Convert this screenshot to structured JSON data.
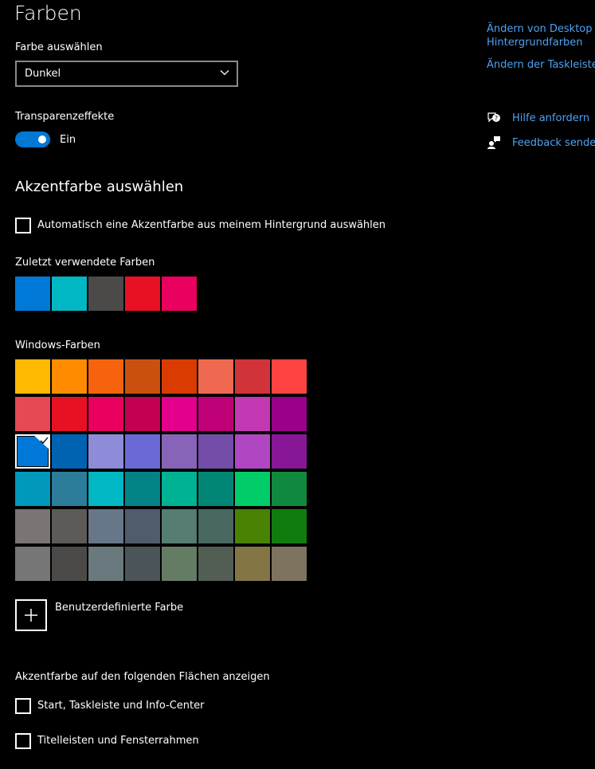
{
  "page": {
    "title": "Farben"
  },
  "color_mode": {
    "label": "Farbe auswählen",
    "selected": "Dunkel"
  },
  "transparency": {
    "label": "Transparenzeffekte",
    "state_label": "Ein",
    "on": true
  },
  "accent": {
    "title": "Akzentfarbe auswählen",
    "auto_label": "Automatisch eine Akzentfarbe aus meinem Hintergrund auswählen",
    "auto_checked": false,
    "recent_label": "Zuletzt verwendete Farben",
    "recent_colors": [
      "#0078d7",
      "#00b7c3",
      "#4c4a48",
      "#e81123",
      "#ea005e"
    ],
    "windows_label": "Windows-Farben",
    "windows_colors": [
      [
        "#ffb900",
        "#ff8c00",
        "#f7630c",
        "#ca5010",
        "#da3b01",
        "#ef6950",
        "#d13438",
        "#ff4343"
      ],
      [
        "#e74856",
        "#e81123",
        "#ea005e",
        "#c30052",
        "#e3008c",
        "#bf0077",
        "#c239b3",
        "#9a0089"
      ],
      [
        "#0078d7",
        "#0063b1",
        "#8e8cd8",
        "#6b69d6",
        "#8764b8",
        "#744da9",
        "#b146c2",
        "#881798"
      ],
      [
        "#0099bc",
        "#2d7d9a",
        "#00b7c3",
        "#038387",
        "#00b294",
        "#018574",
        "#00cc6a",
        "#10893e"
      ],
      [
        "#7a7574",
        "#5d5a58",
        "#68768a",
        "#515c6b",
        "#567c73",
        "#486860",
        "#498205",
        "#107c10"
      ],
      [
        "#767676",
        "#4c4a48",
        "#69797e",
        "#4a5459",
        "#647c64",
        "#525e54",
        "#847545",
        "#7e735f"
      ]
    ],
    "selected_row": 2,
    "selected_col": 0,
    "custom_label": "Benutzerdefinierte Farbe"
  },
  "surfaces": {
    "title": "Akzentfarbe auf den folgenden Flächen anzeigen",
    "options": [
      {
        "label": "Start, Taskleiste und Info-Center",
        "checked": false
      },
      {
        "label": "Titelleisten und Fensterrahmen",
        "checked": false
      }
    ]
  },
  "related": {
    "cut_link_top": "Ändern von Desktop",
    "link_bg_colors": "Hintergrundfarben",
    "link_taskbar": "Ändern der Taskleiste"
  },
  "help": {
    "get_help": "Hilfe anfordern",
    "feedback": "Feedback senden"
  },
  "colors": {
    "accent": "#0078d4",
    "link": "#4ea1f3",
    "background": "#000000"
  }
}
